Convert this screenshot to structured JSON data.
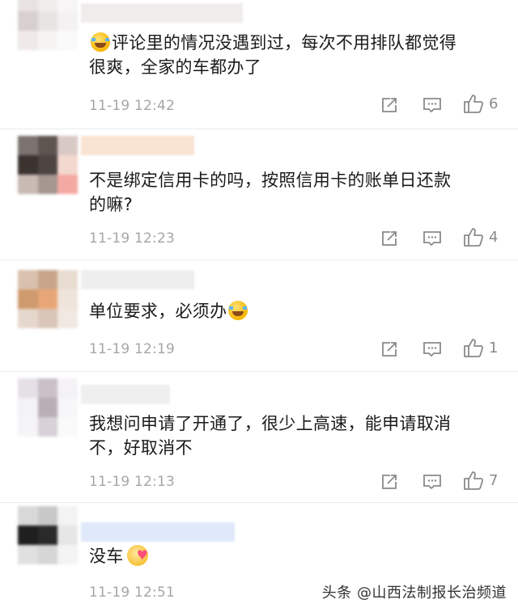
{
  "comments": [
    {
      "text_before": "",
      "emoji_lead": "laughing-tears",
      "text_line1": "评论里的情况没遇到过，每次不用排队都觉得",
      "text_line2": "很爽，全家的车都办了",
      "time": "11-19 12:42",
      "likes": "6",
      "avatar_colors": [
        "#e8e2e2",
        "#f0eded",
        "#f7f5f5",
        "#d8d0ce",
        "#e8e4e3",
        "#f3f1f1",
        "#efe9e9",
        "#f6f3f3",
        "#fbfafa"
      ],
      "username_color": "#f0ecec"
    },
    {
      "text_line1": "不是绑定信用卡的吗，按照信用卡的账单日还款",
      "text_line2": "的嘛?",
      "time": "11-19 12:23",
      "likes": "4",
      "avatar_colors": [
        "#7b7370",
        "#5e5550",
        "#d9c9c4",
        "#3b3330",
        "#4c4541",
        "#f3d8d0",
        "#c9bab3",
        "#a69790",
        "#f5a9a3"
      ],
      "username_color": "#f9e3d3"
    },
    {
      "text_line1": "单位要求，必须办",
      "emoji_trail": "laughing-tears",
      "time": "11-19 12:19",
      "likes": "1",
      "avatar_colors": [
        "#d9c1ad",
        "#c8a68a",
        "#e9ddd2",
        "#cf9a6d",
        "#e8a677",
        "#efe4db",
        "#e6d7cc",
        "#d9c6b8",
        "#f1e8e1"
      ],
      "username_color": "#eeeeee"
    },
    {
      "text_line1": "我想问申请了开通了，很少上高速，能申请取消",
      "text_line2": "不，好取消不",
      "time": "11-19 12:13",
      "likes": "7",
      "avatar_colors": [
        "#e4e0e6",
        "#c9c0c8",
        "#f4f2f5",
        "#f3f2f4",
        "#b8aeb6",
        "#f7f6f8",
        "#f5f4f6",
        "#d8d2d8",
        "#fafafa"
      ],
      "username_color": "#efefef"
    },
    {
      "text_line1": "没车",
      "emoji_trail": "heart-face",
      "time": "11-19 12:51",
      "likes": "",
      "avatar_colors": [
        "#d8d8d8",
        "#c8c8c8",
        "#f3f3f3",
        "#1f1f1f",
        "#2a2a2a",
        "#e6e6e6",
        "#e0e0e0",
        "#d6d6d6",
        "#f4f4f4"
      ],
      "username_color": "#dfe9f9"
    }
  ],
  "watermark": "头条 @山西法制报长治频道",
  "colors": {
    "text": "#1a1a1a",
    "time": "#a6a6a6",
    "icon": "#8a8a8a",
    "divider": "#ececec"
  }
}
